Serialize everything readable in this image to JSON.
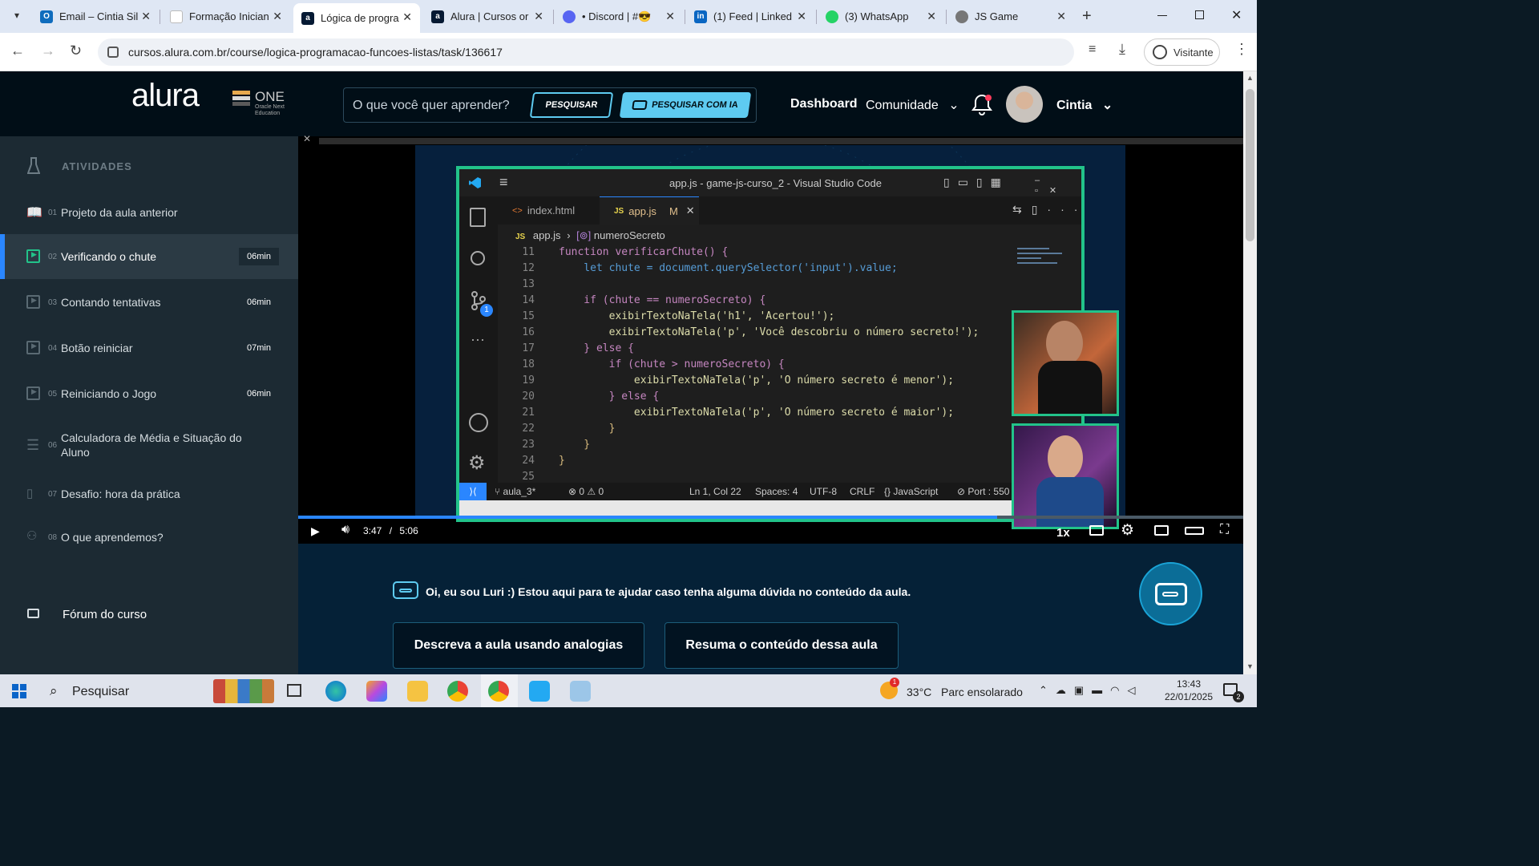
{
  "browser": {
    "tabs": [
      {
        "title": "Email – Cintia Sil",
        "fav_color": "#0f6cbd"
      },
      {
        "title": "Formação Inician",
        "fav_color": "#ffffff"
      },
      {
        "title": "Lógica de progra",
        "fav_color": "#051933",
        "active": true
      },
      {
        "title": "Alura | Cursos or",
        "fav_color": "#051933"
      },
      {
        "title": "• Discord | #😎",
        "fav_color": "#5865f2"
      },
      {
        "title": "(1) Feed | Linked",
        "fav_color": "#0a66c2"
      },
      {
        "title": "(3) WhatsApp",
        "fav_color": "#25d366"
      },
      {
        "title": "JS Game",
        "fav_color": "#777777"
      }
    ],
    "url": "cursos.alura.com.br/course/logica-programacao-funcoes-listas/task/136617",
    "profile_label": "Visitante"
  },
  "header": {
    "logo": "alura",
    "one_title": "ONE",
    "one_sub": "Oracle Next Education",
    "search_placeholder": "O que você quer aprender?",
    "search_button": "PESQUISAR",
    "search_ai_button": "PESQUISAR COM IA",
    "dashboard": "Dashboard",
    "community": "Comunidade",
    "user_name": "Cintia"
  },
  "sidebar": {
    "heading": "ATIVIDADES",
    "items": [
      {
        "num": "01",
        "label": "Projeto da aula anterior",
        "duration": ""
      },
      {
        "num": "02",
        "label": "Verificando o chute",
        "duration": "06min"
      },
      {
        "num": "03",
        "label": "Contando tentativas",
        "duration": "06min"
      },
      {
        "num": "04",
        "label": "Botão reiniciar",
        "duration": "07min"
      },
      {
        "num": "05",
        "label": "Reiniciando o Jogo",
        "duration": "06min"
      },
      {
        "num": "06",
        "label": "Calculadora de Média e Situação do Aluno",
        "duration": ""
      },
      {
        "num": "07",
        "label": "Desafio: hora da prática",
        "duration": ""
      },
      {
        "num": "08",
        "label": "O que aprendemos?",
        "duration": ""
      }
    ],
    "forum": "Fórum do curso"
  },
  "vscode": {
    "title": "app.js - game-js-curso_2 - Visual Studio Code",
    "tab1": "index.html",
    "tab2": "app.js",
    "tab2_flag": "M",
    "breadcrumb_file": "app.js",
    "breadcrumb_symbol": "numeroSecreto",
    "scm_badge": "1",
    "code": [
      {
        "n": "11",
        "t": "function verificarChute() {"
      },
      {
        "n": "12",
        "t": "    let chute = document.querySelector('input').value;"
      },
      {
        "n": "13",
        "t": ""
      },
      {
        "n": "14",
        "t": "    if (chute == numeroSecreto) {"
      },
      {
        "n": "15",
        "t": "        exibirTextoNaTela('h1', 'Acertou!');"
      },
      {
        "n": "16",
        "t": "        exibirTextoNaTela('p', 'Você descobriu o número secreto!');"
      },
      {
        "n": "17",
        "t": "    } else {"
      },
      {
        "n": "18",
        "t": "        if (chute > numeroSecreto) {"
      },
      {
        "n": "19",
        "t": "            exibirTextoNaTela('p', 'O número secreto é menor');"
      },
      {
        "n": "20",
        "t": "        } else {"
      },
      {
        "n": "21",
        "t": "            exibirTextoNaTela('p', 'O número secreto é maior');"
      },
      {
        "n": "22",
        "t": "        }"
      },
      {
        "n": "23",
        "t": "    }"
      },
      {
        "n": "24",
        "t": "}"
      },
      {
        "n": "25",
        "t": ""
      }
    ],
    "status": {
      "branch": "aula_3*",
      "problems": "⊗ 0 ⚠ 0",
      "position": "Ln 1, Col 22",
      "spaces": "Spaces: 4",
      "encoding": "UTF-8",
      "eol": "CRLF",
      "language": "{} JavaScript",
      "port": "⊘ Port : 550"
    }
  },
  "player": {
    "current_time": "3:47",
    "separator": "/",
    "duration": "5:06",
    "progress": 0.74,
    "speed": "1x"
  },
  "luri": {
    "message": "Oi, eu sou Luri :) Estou aqui para te ajudar caso tenha alguma dúvida no conteúdo da aula.",
    "button1": "Descreva a aula usando analogias",
    "button2": "Resuma o conteúdo dessa aula"
  },
  "taskbar": {
    "search": "Pesquisar",
    "weather_temp": "33°C",
    "weather_desc": "Parc ensolarado",
    "weather_badge": "1",
    "time": "13:43",
    "date": "22/01/2025",
    "notif_count": "2"
  },
  "colors": {
    "accent": "#5ecbf1",
    "active_item": "#2a86ff",
    "border_green": "#22c38a"
  }
}
